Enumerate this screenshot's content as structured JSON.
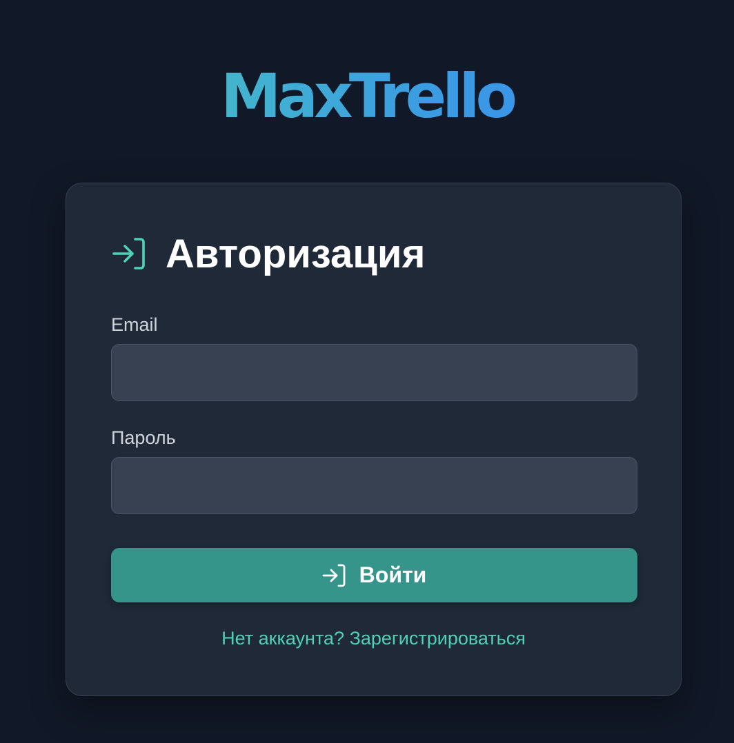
{
  "logo": {
    "text": "MaxTrello",
    "gradient_start": "#4fd1b5",
    "gradient_end": "#3b82f6"
  },
  "card": {
    "title": "Авторизация",
    "title_icon": "login-icon",
    "accent_color": "#4fd1b5"
  },
  "form": {
    "email": {
      "label": "Email",
      "value": "",
      "placeholder": ""
    },
    "password": {
      "label": "Пароль",
      "value": "",
      "placeholder": ""
    },
    "submit": {
      "label": "Войти",
      "icon": "login-icon",
      "color": "#35958a"
    },
    "register_link": "Нет аккаунта? Зарегистрироваться"
  },
  "theme": {
    "background": "#111827",
    "card_background": "#1f2937",
    "input_background": "#374151"
  }
}
